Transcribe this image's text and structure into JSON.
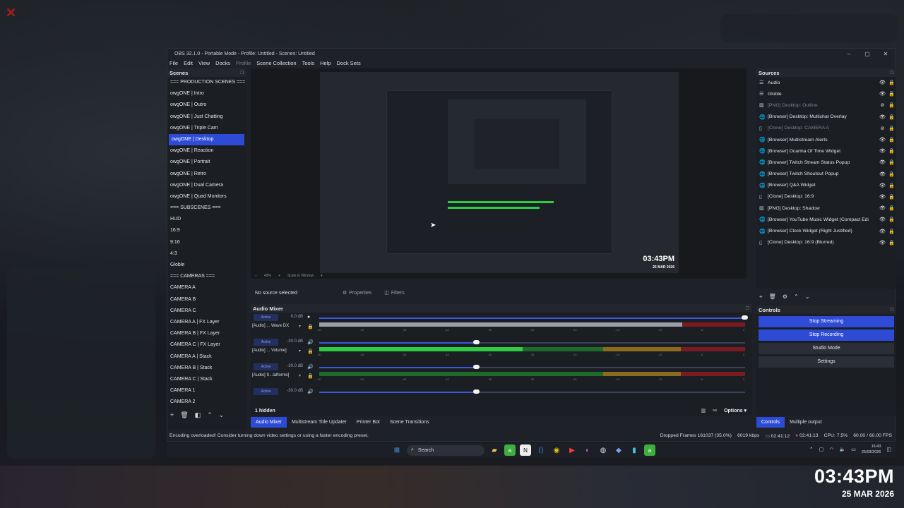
{
  "window": {
    "title": "OBS 32.1.0 - Portable Mode - Profile: Untitled - Scenes: Untitled"
  },
  "menu": [
    "File",
    "Edit",
    "View",
    "Docks",
    "Profile",
    "Scene Collection",
    "Tools",
    "Help",
    "Dock Sets"
  ],
  "scenes": {
    "title": "Scenes",
    "selected_index": 5,
    "items": [
      "=== PRODUCTION SCENES ===",
      "owgONE | Intro",
      "owgONE | Outro",
      "owgONE | Just Chatting",
      "owgONE | Triple Cam",
      "owgONE | Desktop",
      "owgONE | Reaction",
      "owgONE | Portrait",
      "owgONE | Retro",
      "owgONE | Dual Camera",
      "owgONE | Quad Monitors",
      "=== SUBSCENES ===",
      "HUD",
      "16:9",
      "9:16",
      "4:3",
      "Globle",
      "=== CAMERAS ===",
      "CAMERA A",
      "CAMERA B",
      "CAMERA C",
      "CAMERA A | FX Layer",
      "CAMERA B | FX Layer",
      "CAMERA C | FX Layer",
      "CAMERA A | Stack",
      "CAMERA B | Stack",
      "CAMERA C | Stack",
      "CAMERA 1",
      "CAMERA 2",
      "CAMERA 3"
    ]
  },
  "preview": {
    "time": "03:43PM",
    "date": "25 MAR 2026",
    "zoom": "49%",
    "scale_mode": "Scale to Window"
  },
  "source_bar": {
    "no_source": "No source selected",
    "properties": "Properties",
    "filters": "Filters"
  },
  "mixer": {
    "title": "Audio Mixer",
    "tracks": [
      {
        "state": "Active",
        "db": "0.0 dB",
        "name": "[Audio] ... Wave DX",
        "volume": 1.0
      },
      {
        "state": "Active",
        "db": "-30.0 dB",
        "name": "[Audio] ... Volume]",
        "volume": 0.37
      },
      {
        "state": "Active",
        "db": "-30.0 dB",
        "name": "[Audio] S...latforms]",
        "volume": 0.37
      },
      {
        "state": "Active",
        "db": "-30.0 dB",
        "name": "",
        "volume": 0.37
      }
    ],
    "ticks": [
      "-60",
      "-54",
      "-48",
      "-42",
      "-36",
      "-30",
      "-24",
      "-18",
      "-12",
      "-6",
      "0"
    ],
    "hidden_label": "1 hidden",
    "options_label": "Options"
  },
  "bottom_tabs": [
    "Audio Mixer",
    "Multistream Title Updater",
    "Printer Bot",
    "Scene Transitions"
  ],
  "right_tabs": [
    "Controls",
    "Multiple output"
  ],
  "sources": {
    "title": "Sources",
    "items": [
      {
        "icon": "list-icon",
        "name": "Audio",
        "visible": true
      },
      {
        "icon": "list-icon",
        "name": "Globle",
        "visible": true
      },
      {
        "icon": "image-icon",
        "name": "[PNG] Desktop: Outline",
        "visible": false
      },
      {
        "icon": "globe-icon",
        "name": "[Browser] Desktop: Multichat Overlay",
        "visible": true
      },
      {
        "icon": "clone-icon",
        "name": "[Clone] Desktop: CAMERA A",
        "visible": false
      },
      {
        "icon": "globe-icon",
        "name": "[Browser] Multistream Alerts",
        "visible": true
      },
      {
        "icon": "globe-icon",
        "name": "[Browser] Ocarina Of Time Widget",
        "visible": true
      },
      {
        "icon": "globe-icon",
        "name": "[Browser] Twitch Stream Status Popup",
        "visible": true
      },
      {
        "icon": "globe-icon",
        "name": "[Browser] Twitch Shoutout Popup",
        "visible": true
      },
      {
        "icon": "globe-icon",
        "name": "[Browser] Q&A Widget",
        "visible": true
      },
      {
        "icon": "clone-icon",
        "name": "[Clone] Desktop: 16:9",
        "visible": true
      },
      {
        "icon": "image-icon",
        "name": "[PNG] Desktop: Shadow",
        "visible": true
      },
      {
        "icon": "globe-icon",
        "name": "[Browser] YouTube Music Widget (Compact Edi",
        "visible": true
      },
      {
        "icon": "globe-icon",
        "name": "[Browser] Clock Widget (Right Justified)",
        "visible": true
      },
      {
        "icon": "clone-icon",
        "name": "[Clone] Desktop: 16:9 (Blurred)",
        "visible": true
      }
    ]
  },
  "controls": {
    "title": "Controls",
    "stop_streaming": "Stop Streaming",
    "stop_recording": "Stop Recording",
    "studio_mode": "Studio Mode",
    "settings": "Settings"
  },
  "status": {
    "message": "Encoding overloaded! Consider turning down video settings or using a faster encoding preset.",
    "dropped_frames": "Dropped Frames 161037 (35.0%)",
    "bitrate": "6019 kbps",
    "stream_time": "02:41:12",
    "record_time": "02:41:13",
    "cpu": "CPU: 7.5%",
    "fps": "60.00 / 60.00 FPS"
  },
  "taskbar": {
    "search_placeholder": "Search",
    "time": "15:43",
    "date": "25/03/2026"
  },
  "overlay": {
    "time": "03:43PM",
    "date": "25 MAR 2026"
  },
  "colors": {
    "accent": "#2e4bd6",
    "meter_green": "#2ecc40",
    "meter_yellow": "#8a6a1c",
    "meter_red": "#7a1b22"
  }
}
